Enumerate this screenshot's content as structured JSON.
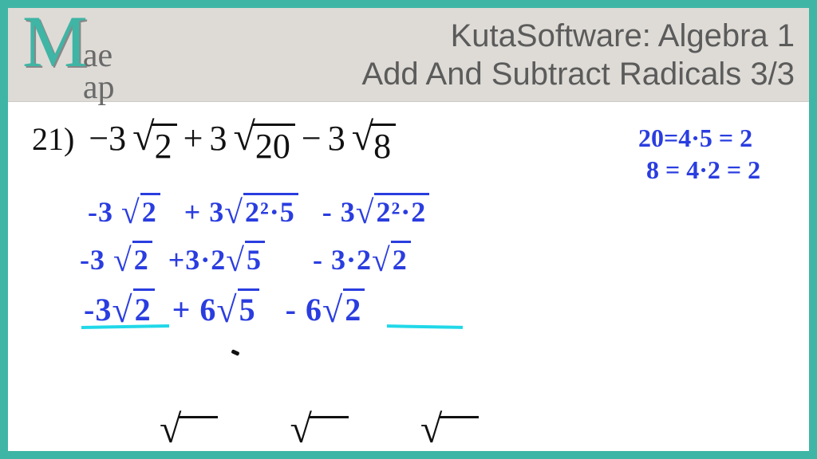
{
  "header": {
    "logo_big": "M",
    "logo_top": "ae",
    "logo_bot": "ap",
    "title_line1": "KutaSoftware: Algebra 1",
    "title_line2": "Add And Subtract Radicals 3/3"
  },
  "problem": {
    "number": "21)",
    "t1_coef": "−3",
    "t1_rad": "2",
    "op1": "+",
    "t2_coef": "3",
    "t2_rad": "20",
    "op2": "−",
    "t3_coef": "3",
    "t3_rad": "8"
  },
  "work": {
    "line1": {
      "a": "-3",
      "ar": "2",
      "plus": "+ 3",
      "br": "2²·5",
      "minus": "- 3",
      "cr": "2²·2"
    },
    "line2": {
      "a": "-3",
      "ar": "2",
      "plus": "+3·2",
      "br": "5",
      "minus": "- 3·2",
      "cr": "2"
    },
    "line3": {
      "a": "-3",
      "ar": "2",
      "plus": "+ 6",
      "br": "5",
      "minus": "-  6",
      "cr": "2"
    }
  },
  "side": {
    "s1": "20=4·5 = 2",
    "s2": "8 = 4·2 = 2"
  }
}
